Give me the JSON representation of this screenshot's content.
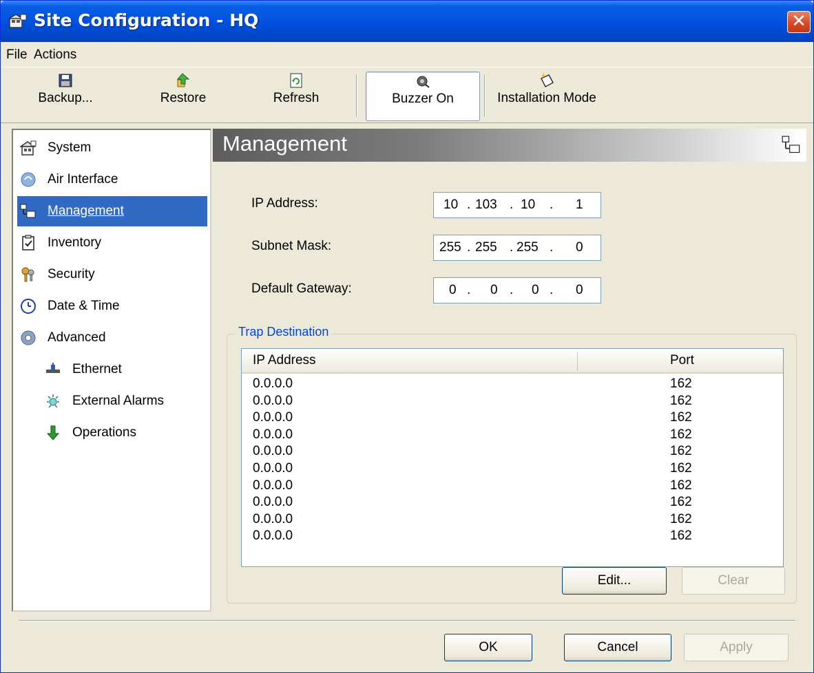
{
  "window": {
    "title": "Site Configuration - HQ",
    "close_glyph": "✕"
  },
  "menu": {
    "file": "File",
    "actions": "Actions"
  },
  "toolbar": {
    "backup": {
      "label": "Backup...",
      "icon": "floppy-disk-icon"
    },
    "restore": {
      "label": "Restore",
      "icon": "restore-arrow-icon"
    },
    "refresh": {
      "label": "Refresh",
      "icon": "refresh-icon"
    },
    "buzzer": {
      "label": "Buzzer On",
      "icon": "buzzer-icon"
    },
    "installation": {
      "label": "Installation Mode",
      "icon": "installation-icon"
    }
  },
  "nav": {
    "items": [
      {
        "label": "System",
        "icon": "system-icon"
      },
      {
        "label": "Air Interface",
        "icon": "air-interface-icon"
      },
      {
        "label": "Management",
        "icon": "management-icon",
        "selected": true
      },
      {
        "label": "Inventory",
        "icon": "inventory-icon"
      },
      {
        "label": "Security",
        "icon": "security-keys-icon"
      },
      {
        "label": "Date & Time",
        "icon": "clock-icon"
      },
      {
        "label": "Advanced",
        "icon": "gear-icon"
      },
      {
        "label": "Ethernet",
        "icon": "ethernet-icon"
      },
      {
        "label": "External Alarms",
        "icon": "alarm-icon"
      },
      {
        "label": "Operations",
        "icon": "green-down-arrow-icon"
      }
    ]
  },
  "content": {
    "banner_title": "Management",
    "fields": {
      "ip_address": {
        "label": "IP Address:",
        "octets": [
          "10",
          "103",
          "10",
          "1"
        ]
      },
      "subnet_mask": {
        "label": "Subnet Mask:",
        "octets": [
          "255",
          "255",
          "255",
          "0"
        ]
      },
      "default_gateway": {
        "label": "Default Gateway:",
        "octets": [
          "0",
          "0",
          "0",
          "0"
        ]
      }
    },
    "trap": {
      "legend": "Trap Destination",
      "columns": [
        "IP Address",
        "Port"
      ],
      "rows": [
        [
          "0.0.0.0",
          "162"
        ],
        [
          "0.0.0.0",
          "162"
        ],
        [
          "0.0.0.0",
          "162"
        ],
        [
          "0.0.0.0",
          "162"
        ],
        [
          "0.0.0.0",
          "162"
        ],
        [
          "0.0.0.0",
          "162"
        ],
        [
          "0.0.0.0",
          "162"
        ],
        [
          "0.0.0.0",
          "162"
        ],
        [
          "0.0.0.0",
          "162"
        ],
        [
          "0.0.0.0",
          "162"
        ]
      ],
      "edit_label": "Edit...",
      "clear_label": "Clear"
    }
  },
  "footer": {
    "ok": "OK",
    "cancel": "Cancel",
    "apply": "Apply"
  },
  "colors": {
    "titlebar": "#0052e0",
    "selection": "#316ac5",
    "dialog_bg": "#ece9d8",
    "legend": "#0046d5"
  }
}
